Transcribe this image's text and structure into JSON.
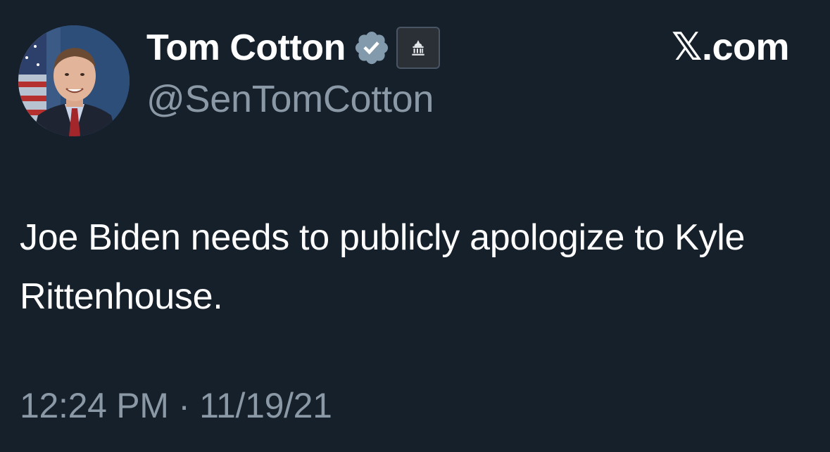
{
  "author": {
    "display_name": "Tom Cotton",
    "handle": "@SenTomCotton",
    "verified_icon": "verified-badge-icon",
    "affiliation_icon": "government-building-icon"
  },
  "site": {
    "label": "𝕏.com"
  },
  "tweet": {
    "text": "Joe Biden needs to publicly apologize to Kyle Rittenhouse.",
    "time": "12:24 PM",
    "separator": "·",
    "date": "11/19/21"
  },
  "colors": {
    "background": "#15202b",
    "primary_text": "#ffffff",
    "secondary_text": "#8b98a5",
    "verified_badge": "#829aab"
  }
}
